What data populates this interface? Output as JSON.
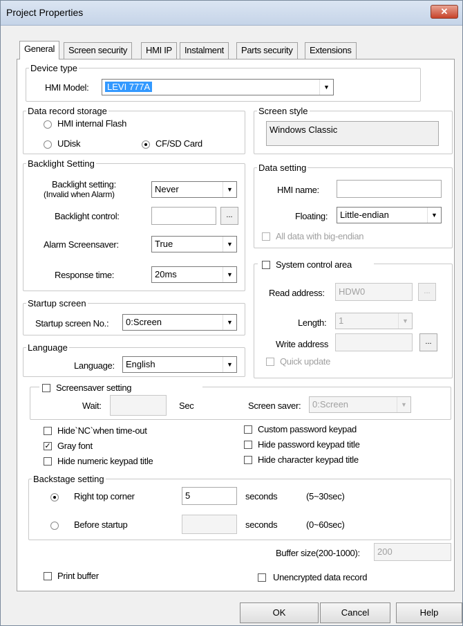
{
  "window": {
    "title": "Project Properties",
    "close_glyph": "✕"
  },
  "tabs": [
    {
      "label": "General",
      "active": true
    },
    {
      "label": "Screen security"
    },
    {
      "label": "HMI IP"
    },
    {
      "label": "Instalment"
    },
    {
      "label": "Parts security"
    },
    {
      "label": "Extensions"
    }
  ],
  "device_type": {
    "legend": "Device type",
    "label": "HMI Model:",
    "value": "LEVI 777A"
  },
  "data_record": {
    "legend": "Data record storage",
    "options": [
      "HMI internal Flash",
      "UDisk",
      "CF/SD Card"
    ],
    "selected": "CF/SD Card"
  },
  "screen_style": {
    "legend": "Screen style",
    "value": "Windows Classic"
  },
  "backlight": {
    "legend": "Backlight Setting",
    "setting_label_1": "Backlight setting:",
    "setting_label_2": "(Invalid when Alarm)",
    "setting_value": "Never",
    "control_label": "Backlight control:",
    "control_value": "",
    "browse": "...",
    "alarm_label": "Alarm Screensaver:",
    "alarm_value": "True",
    "response_label": "Response time:",
    "response_value": "20ms"
  },
  "data_setting": {
    "legend": "Data setting",
    "hmi_name_label": "HMI name:",
    "hmi_name_value": "",
    "floating_label": "Floating:",
    "floating_value": "Little-endian",
    "big_endian_label": "All data with big-endian",
    "big_endian_checked": false
  },
  "system_control": {
    "legend": "System control area",
    "checked": false,
    "read_label": "Read address:",
    "read_value": "HDW0",
    "length_label": "Length:",
    "length_value": "1",
    "write_label": "Write address",
    "write_value": "",
    "browse": "...",
    "quick_update_label": "Quick update",
    "quick_update_checked": false
  },
  "startup": {
    "legend": "Startup screen",
    "label": "Startup screen No.:",
    "value": "0:Screen"
  },
  "language": {
    "legend": "Language",
    "label": "Language:",
    "value": "English"
  },
  "screensaver": {
    "legend": "Screensaver setting",
    "checked": false,
    "wait_label": "Wait:",
    "wait_value": "",
    "sec_label": "Sec",
    "saver_label": "Screen saver:",
    "saver_value": "0:Screen"
  },
  "options_left": [
    {
      "label": "Hide`NC`when time-out",
      "checked": false
    },
    {
      "label": "Gray font",
      "checked": true
    },
    {
      "label": "Hide numeric keypad title",
      "checked": false
    }
  ],
  "options_right": [
    {
      "label": "Custom password keypad",
      "checked": false
    },
    {
      "label": "Hide password keypad title",
      "checked": false
    },
    {
      "label": "Hide character keypad title",
      "checked": false
    }
  ],
  "backstage": {
    "legend": "Backstage setting",
    "selected": "Right top corner",
    "right_top_label": "Right top corner",
    "right_top_value": "5",
    "right_top_unit": "seconds",
    "right_top_range": "(5~30sec)",
    "before_label": "Before startup",
    "before_value": "",
    "before_unit": "seconds",
    "before_range": "(0~60sec)"
  },
  "buffer": {
    "label": "Buffer size(200-1000):",
    "value": "200"
  },
  "print_buffer": {
    "label": "Print buffer",
    "checked": false
  },
  "unencrypted": {
    "label": "Unencrypted data record",
    "checked": false
  },
  "buttons": {
    "ok": "OK",
    "cancel": "Cancel",
    "help": "Help"
  }
}
